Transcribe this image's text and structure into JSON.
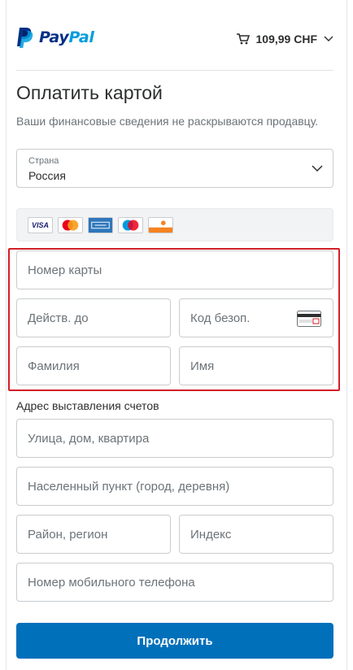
{
  "header": {
    "brand_pay": "Pay",
    "brand_pal": "Pal",
    "cart_total": "109,99 CHF",
    "cart_icon": "shopping-cart-icon",
    "chevron_icon": "chevron-down-icon"
  },
  "main": {
    "title": "Оплатить картой",
    "subtitle": "Ваши финансовые сведения не раскрываются продавцу."
  },
  "country": {
    "label": "Страна",
    "value": "Россия"
  },
  "card_brands": [
    {
      "name": "VISA",
      "icon": "visa-icon"
    },
    {
      "name": "MasterCard",
      "icon": "mastercard-icon"
    },
    {
      "name": "American Express",
      "icon": "amex-icon"
    },
    {
      "name": "Maestro",
      "icon": "maestro-icon"
    },
    {
      "name": "DISCOVER",
      "icon": "discover-icon"
    }
  ],
  "card_fields": {
    "card_number_placeholder": "Номер карты",
    "expiry_placeholder": "Действ. до",
    "cvv_placeholder": "Код безоп.",
    "last_name_placeholder": "Фамилия",
    "first_name_placeholder": "Имя"
  },
  "billing": {
    "section_label": "Адрес выставления счетов",
    "street_placeholder": "Улица, дом, квартира",
    "city_placeholder": "Населенный пункт (город, деревня)",
    "region_placeholder": "Район, регион",
    "zip_placeholder": "Индекс",
    "phone_placeholder": "Номер мобильного телефона"
  },
  "actions": {
    "continue_label": "Продолжить"
  },
  "colors": {
    "brand_dark": "#003087",
    "brand_light": "#009cde",
    "primary_button": "#0070ba",
    "highlight_border": "#d31f26"
  }
}
